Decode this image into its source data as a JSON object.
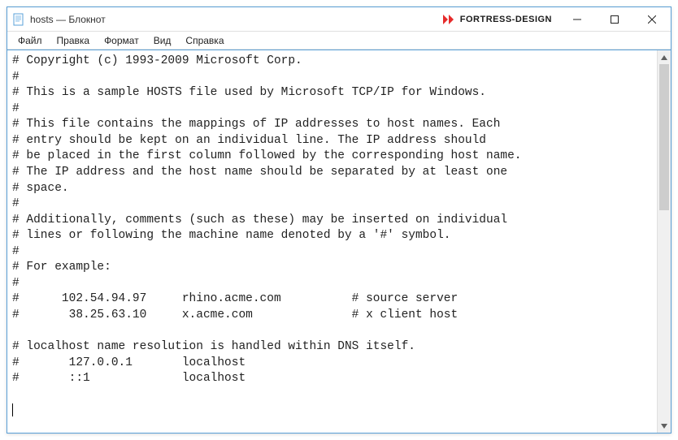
{
  "titlebar": {
    "title": "hosts — Блокнот",
    "brand": "FORTRESS-DESIGN"
  },
  "menubar": {
    "items": [
      "Файл",
      "Правка",
      "Формат",
      "Вид",
      "Справка"
    ]
  },
  "editor": {
    "content": "# Copyright (c) 1993-2009 Microsoft Corp.\n#\n# This is a sample HOSTS file used by Microsoft TCP/IP for Windows.\n#\n# This file contains the mappings of IP addresses to host names. Each\n# entry should be kept on an individual line. The IP address should\n# be placed in the first column followed by the corresponding host name.\n# The IP address and the host name should be separated by at least one\n# space.\n#\n# Additionally, comments (such as these) may be inserted on individual\n# lines or following the machine name denoted by a '#' symbol.\n#\n# For example:\n#\n#      102.54.94.97     rhino.acme.com          # source server\n#       38.25.63.10     x.acme.com              # x client host\n\n# localhost name resolution is handled within DNS itself.\n#       127.0.0.1       localhost\n#       ::1             localhost\n"
  }
}
